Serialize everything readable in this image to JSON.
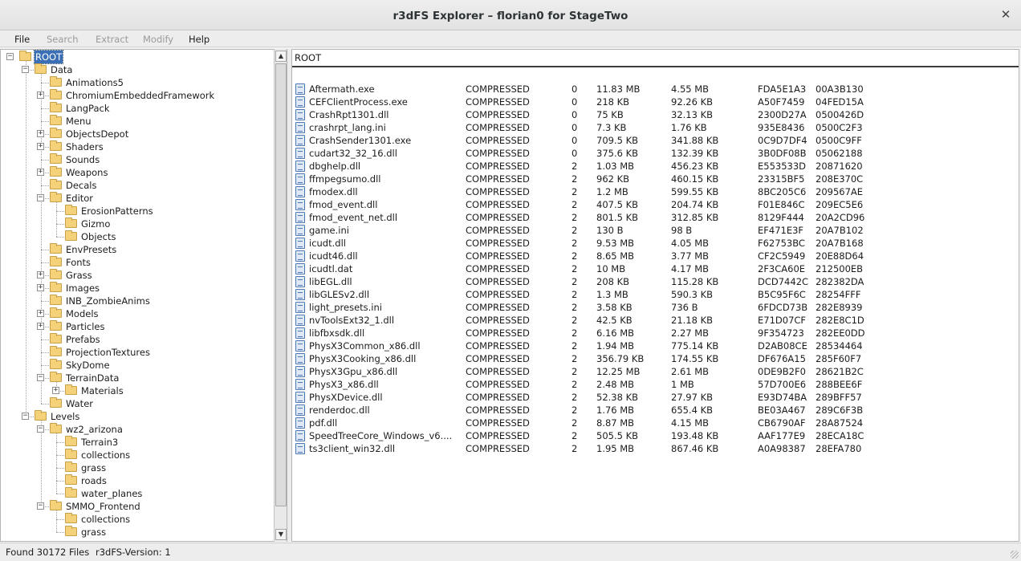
{
  "window": {
    "title": "r3dFS Explorer – florian0 for StageTwo"
  },
  "menu": {
    "items": [
      {
        "label": "File",
        "enabled": true
      },
      {
        "label": "Search",
        "enabled": false
      },
      {
        "label": "Extract",
        "enabled": false
      },
      {
        "label": "Modify",
        "enabled": false
      },
      {
        "label": "Help",
        "enabled": true
      }
    ]
  },
  "tree": {
    "nodes": [
      {
        "label": "ROOT",
        "depth": 0,
        "expander": "-",
        "selected": true
      },
      {
        "label": "Data",
        "depth": 1,
        "expander": "-"
      },
      {
        "label": "Animations5",
        "depth": 2,
        "expander": ""
      },
      {
        "label": "ChromiumEmbeddedFramework",
        "depth": 2,
        "expander": "+"
      },
      {
        "label": "LangPack",
        "depth": 2,
        "expander": ""
      },
      {
        "label": "Menu",
        "depth": 2,
        "expander": ""
      },
      {
        "label": "ObjectsDepot",
        "depth": 2,
        "expander": "+"
      },
      {
        "label": "Shaders",
        "depth": 2,
        "expander": "+"
      },
      {
        "label": "Sounds",
        "depth": 2,
        "expander": ""
      },
      {
        "label": "Weapons",
        "depth": 2,
        "expander": "+"
      },
      {
        "label": "Decals",
        "depth": 2,
        "expander": ""
      },
      {
        "label": "Editor",
        "depth": 2,
        "expander": "-"
      },
      {
        "label": "ErosionPatterns",
        "depth": 3,
        "expander": ""
      },
      {
        "label": "Gizmo",
        "depth": 3,
        "expander": ""
      },
      {
        "label": "Objects",
        "depth": 3,
        "expander": ""
      },
      {
        "label": "EnvPresets",
        "depth": 2,
        "expander": ""
      },
      {
        "label": "Fonts",
        "depth": 2,
        "expander": ""
      },
      {
        "label": "Grass",
        "depth": 2,
        "expander": "+"
      },
      {
        "label": "Images",
        "depth": 2,
        "expander": "+"
      },
      {
        "label": "INB_ZombieAnims",
        "depth": 2,
        "expander": ""
      },
      {
        "label": "Models",
        "depth": 2,
        "expander": "+"
      },
      {
        "label": "Particles",
        "depth": 2,
        "expander": "+"
      },
      {
        "label": "Prefabs",
        "depth": 2,
        "expander": ""
      },
      {
        "label": "ProjectionTextures",
        "depth": 2,
        "expander": ""
      },
      {
        "label": "SkyDome",
        "depth": 2,
        "expander": ""
      },
      {
        "label": "TerrainData",
        "depth": 2,
        "expander": "-"
      },
      {
        "label": "Materials",
        "depth": 3,
        "expander": "+"
      },
      {
        "label": "Water",
        "depth": 2,
        "expander": ""
      },
      {
        "label": "Levels",
        "depth": 1,
        "expander": "-"
      },
      {
        "label": "wz2_arizona",
        "depth": 2,
        "expander": "-"
      },
      {
        "label": "Terrain3",
        "depth": 3,
        "expander": ""
      },
      {
        "label": "collections",
        "depth": 3,
        "expander": ""
      },
      {
        "label": "grass",
        "depth": 3,
        "expander": ""
      },
      {
        "label": "roads",
        "depth": 3,
        "expander": ""
      },
      {
        "label": "water_planes",
        "depth": 3,
        "expander": ""
      },
      {
        "label": "SMMO_Frontend",
        "depth": 2,
        "expander": "-"
      },
      {
        "label": "collections",
        "depth": 3,
        "expander": ""
      },
      {
        "label": "grass",
        "depth": 3,
        "expander": ""
      }
    ]
  },
  "list": {
    "path": "ROOT",
    "files": [
      [
        "Aftermath.exe",
        "COMPRESSED",
        "0",
        "11.83 MB",
        "4.55 MB",
        "FDA5E1A3",
        "00A3B130"
      ],
      [
        "CEFClientProcess.exe",
        "COMPRESSED",
        "0",
        "218 KB",
        "92.26 KB",
        "A50F7459",
        "04FED15A"
      ],
      [
        "CrashRpt1301.dll",
        "COMPRESSED",
        "0",
        "75 KB",
        "32.13 KB",
        "2300D27A",
        "0500426D"
      ],
      [
        "crashrpt_lang.ini",
        "COMPRESSED",
        "0",
        "7.3 KB",
        "1.76 KB",
        "935E8436",
        "0500C2F3"
      ],
      [
        "CrashSender1301.exe",
        "COMPRESSED",
        "0",
        "709.5 KB",
        "341.88 KB",
        "0C9D7DF4",
        "0500C9FF"
      ],
      [
        "cudart32_32_16.dll",
        "COMPRESSED",
        "0",
        "375.6 KB",
        "132.39 KB",
        "3B0DF08B",
        "05062188"
      ],
      [
        "dbghelp.dll",
        "COMPRESSED",
        "2",
        "1.03 MB",
        "456.23 KB",
        "E553533D",
        "20871620"
      ],
      [
        "ffmpegsumo.dll",
        "COMPRESSED",
        "2",
        "962 KB",
        "460.15 KB",
        "23315BF5",
        "208E370C"
      ],
      [
        "fmodex.dll",
        "COMPRESSED",
        "2",
        "1.2 MB",
        "599.55 KB",
        "8BC205C6",
        "209567AE"
      ],
      [
        "fmod_event.dll",
        "COMPRESSED",
        "2",
        "407.5 KB",
        "204.74 KB",
        "F01E846C",
        "209EC5E6"
      ],
      [
        "fmod_event_net.dll",
        "COMPRESSED",
        "2",
        "801.5 KB",
        "312.85 KB",
        "8129F444",
        "20A2CD96"
      ],
      [
        "game.ini",
        "COMPRESSED",
        "2",
        "130 B",
        "98 B",
        "EF471E3F",
        "20A7B102"
      ],
      [
        "icudt.dll",
        "COMPRESSED",
        "2",
        "9.53 MB",
        "4.05 MB",
        "F62753BC",
        "20A7B168"
      ],
      [
        "icudt46.dll",
        "COMPRESSED",
        "2",
        "8.65 MB",
        "3.77 MB",
        "CF2C5949",
        "20E88D64"
      ],
      [
        "icudtl.dat",
        "COMPRESSED",
        "2",
        "10 MB",
        "4.17 MB",
        "2F3CA60E",
        "212500EB"
      ],
      [
        "libEGL.dll",
        "COMPRESSED",
        "2",
        "208 KB",
        "115.28 KB",
        "DCD7442C",
        "282382DA"
      ],
      [
        "libGLESv2.dll",
        "COMPRESSED",
        "2",
        "1.3 MB",
        "590.3 KB",
        "B5C95F6C",
        "28254FFF"
      ],
      [
        "light_presets.ini",
        "COMPRESSED",
        "2",
        "3.58 KB",
        "736 B",
        "6FDCD73B",
        "282E8939"
      ],
      [
        "nvToolsExt32_1.dll",
        "COMPRESSED",
        "2",
        "42.5 KB",
        "21.18 KB",
        "E71D07CF",
        "282E8C1D"
      ],
      [
        "libfbxsdk.dll",
        "COMPRESSED",
        "2",
        "6.16 MB",
        "2.27 MB",
        "9F354723",
        "282EE0DD"
      ],
      [
        "PhysX3Common_x86.dll",
        "COMPRESSED",
        "2",
        "1.94 MB",
        "775.14 KB",
        "D2AB08CE",
        "28534464"
      ],
      [
        "PhysX3Cooking_x86.dll",
        "COMPRESSED",
        "2",
        "356.79 KB",
        "174.55 KB",
        "DF676A15",
        "285F60F7"
      ],
      [
        "PhysX3Gpu_x86.dll",
        "COMPRESSED",
        "2",
        "12.25 MB",
        "2.61 MB",
        "0DE9B2F0",
        "28621B2C"
      ],
      [
        "PhysX3_x86.dll",
        "COMPRESSED",
        "2",
        "2.48 MB",
        "1 MB",
        "57D700E6",
        "288BEE6F"
      ],
      [
        "PhysXDevice.dll",
        "COMPRESSED",
        "2",
        "52.38 KB",
        "27.97 KB",
        "E93D74BA",
        "289BFF57"
      ],
      [
        "renderdoc.dll",
        "COMPRESSED",
        "2",
        "1.76 MB",
        "655.4 KB",
        "BE03A467",
        "289C6F3B"
      ],
      [
        "pdf.dll",
        "COMPRESSED",
        "2",
        "8.87 MB",
        "4.15 MB",
        "CB6790AF",
        "28A87524"
      ],
      [
        "SpeedTreeCore_Windows_v6....",
        "COMPRESSED",
        "2",
        "505.5 KB",
        "193.48 KB",
        "AAF177E9",
        "28ECA18C"
      ],
      [
        "ts3client_win32.dll",
        "COMPRESSED",
        "2",
        "1.95 MB",
        "867.46 KB",
        "A0A98387",
        "28EFA780"
      ]
    ]
  },
  "status": {
    "found": "Found 30172 Files",
    "version": "r3dFS-Version: 1"
  }
}
